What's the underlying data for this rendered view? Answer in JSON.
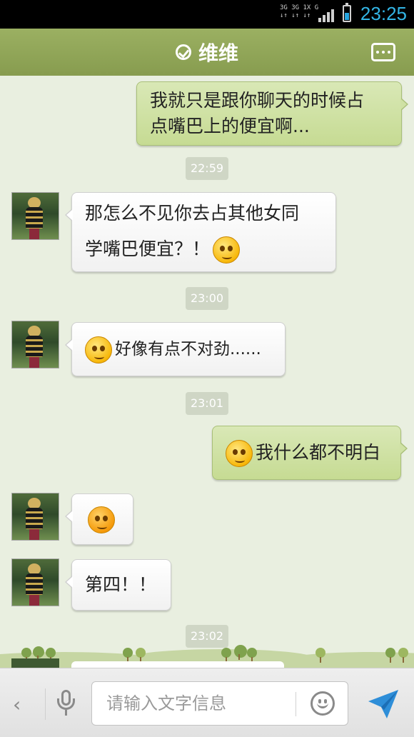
{
  "status_bar": {
    "network_line1": "3G 3G 1X G",
    "network_line2": "↓↑ ↓↑ ↓↑",
    "time": "23:25",
    "accent_color": "#33b5e5"
  },
  "header": {
    "title": "维维",
    "status_icon": "check-circle-icon",
    "menu_icon": "more-options-icon",
    "color": "#8ea256"
  },
  "messages": [
    {
      "side": "out",
      "text": "我就只是跟你聊天的时候占\n点嘴巴上的便宜啊..."
    },
    {
      "side": "time",
      "text": "22:59"
    },
    {
      "side": "in",
      "text1": "那怎么不见你去占其他女同",
      "text2": "学嘴巴便宜？！",
      "emoji": "smirk-emoji"
    },
    {
      "side": "time",
      "text": "23:00"
    },
    {
      "side": "in",
      "text": "好像有点不对劲......",
      "emoji": "confused-emoji"
    },
    {
      "side": "time",
      "text": "23:01"
    },
    {
      "side": "out",
      "text": "我什么都不明白",
      "emoji": "puzzled-emoji"
    },
    {
      "side": "in",
      "emoji": "angry-emoji"
    },
    {
      "side": "in",
      "text": "第四！！"
    },
    {
      "side": "time",
      "text": "23:02"
    }
  ],
  "input_bar": {
    "placeholder": "请输入文字信息",
    "icons": [
      "back-arrow-icon",
      "microphone-icon",
      "emoji-icon",
      "send-icon"
    ]
  }
}
